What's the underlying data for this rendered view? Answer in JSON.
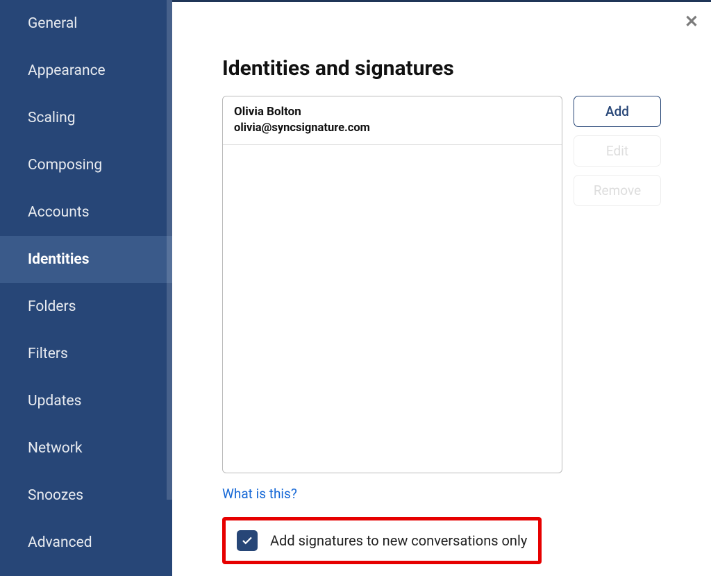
{
  "sidebar": {
    "items": [
      {
        "label": "General",
        "active": false
      },
      {
        "label": "Appearance",
        "active": false
      },
      {
        "label": "Scaling",
        "active": false
      },
      {
        "label": "Composing",
        "active": false
      },
      {
        "label": "Accounts",
        "active": false
      },
      {
        "label": "Identities",
        "active": true
      },
      {
        "label": "Folders",
        "active": false
      },
      {
        "label": "Filters",
        "active": false
      },
      {
        "label": "Updates",
        "active": false
      },
      {
        "label": "Network",
        "active": false
      },
      {
        "label": "Snoozes",
        "active": false
      },
      {
        "label": "Advanced",
        "active": false
      }
    ]
  },
  "main": {
    "title": "Identities and signatures",
    "identities": [
      {
        "name": "Olivia Bolton",
        "email": "olivia@syncsignature.com"
      }
    ],
    "buttons": {
      "add": "Add",
      "edit": "Edit",
      "remove": "Remove"
    },
    "help_link": "What is this?",
    "checkbox": {
      "label": "Add signatures to new conversations only",
      "checked": true
    }
  }
}
